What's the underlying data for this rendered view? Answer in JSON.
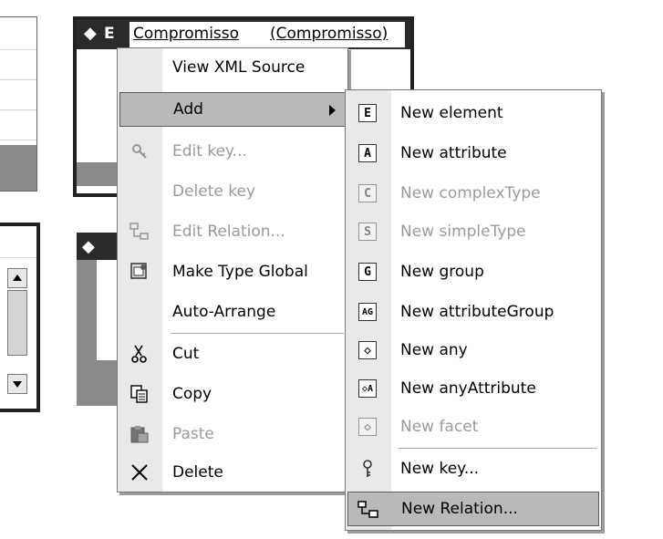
{
  "title_bar": {
    "element_prefix": "E",
    "element_name": "Compromisso",
    "element_type": "(Compromisso)"
  },
  "context_menu": {
    "items": [
      {
        "label": "View XML Source",
        "icon": "none",
        "enabled": true
      },
      {
        "label": "Add",
        "icon": "none",
        "enabled": true,
        "submenu": true
      },
      {
        "label": "Edit key...",
        "icon": "key-edit-icon",
        "enabled": false
      },
      {
        "label": "Delete key",
        "icon": "none",
        "enabled": false
      },
      {
        "label": "Edit Relation...",
        "icon": "relation-edit-icon",
        "enabled": false
      },
      {
        "label": "Make Type Global",
        "icon": "make-global-icon",
        "enabled": true
      },
      {
        "label": "Auto-Arrange",
        "icon": "none",
        "enabled": true
      },
      {
        "label": "Cut",
        "icon": "scissors-icon",
        "enabled": true
      },
      {
        "label": "Copy",
        "icon": "copy-icon",
        "enabled": true
      },
      {
        "label": "Paste",
        "icon": "paste-icon",
        "enabled": false
      },
      {
        "label": "Delete",
        "icon": "delete-x-icon",
        "enabled": true
      }
    ]
  },
  "submenu": {
    "items": [
      {
        "label": "New element",
        "glyph": "E",
        "enabled": true
      },
      {
        "label": "New attribute",
        "glyph": "A",
        "enabled": true
      },
      {
        "label": "New complexType",
        "glyph": "C",
        "enabled": false
      },
      {
        "label": "New simpleType",
        "glyph": "S",
        "enabled": false
      },
      {
        "label": "New group",
        "glyph": "G",
        "enabled": true
      },
      {
        "label": "New attributeGroup",
        "glyph": "AG",
        "enabled": true
      },
      {
        "label": "New any",
        "glyph": "◇",
        "enabled": true
      },
      {
        "label": "New anyAttribute",
        "glyph": "◇A",
        "enabled": true
      },
      {
        "label": "New facet",
        "glyph": "◇",
        "enabled": false
      },
      {
        "label": "New key...",
        "glyph": "key",
        "enabled": true
      },
      {
        "label": "New Relation...",
        "glyph": "rel",
        "enabled": true
      }
    ]
  },
  "colors": {
    "menu_bg": "#ffffff",
    "gutter": "#e9e9e9",
    "selected": "#b9b9b9",
    "disabled_text": "#9a9a9a",
    "frame": "#222222"
  }
}
